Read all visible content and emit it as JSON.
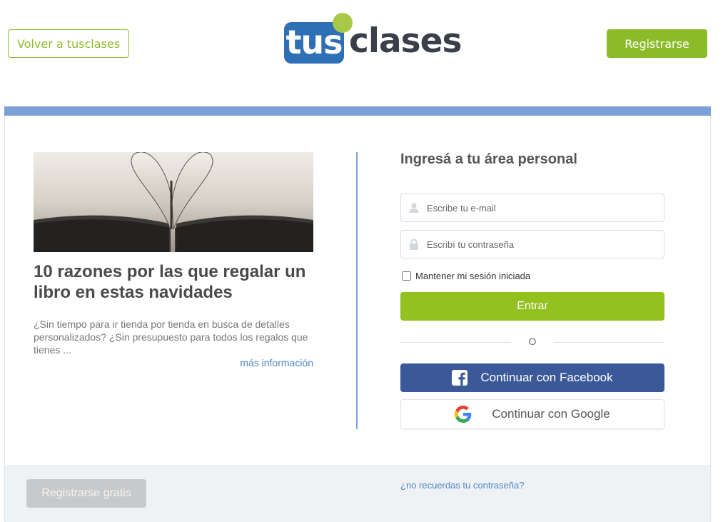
{
  "header": {
    "back_label": "Volver a tusclases",
    "register_label": "Registrarse",
    "logo": {
      "part1": "tus",
      "part2": "clases"
    }
  },
  "article": {
    "image": "open-book-heart-pages",
    "title": "10 razones por las que regalar un libro en estas navidades",
    "description": "¿Sin tiempo para ir tienda por tienda en busca de detalles personalizados? ¿Sin presupuesto para todos los regalos que tienes ...",
    "more_link": "más información"
  },
  "login": {
    "title": "Ingresá a tu área personal",
    "email_placeholder": "Escribe tu e-mail",
    "password_placeholder": "Escribí tu contraseña",
    "remember_label": "Mantener mi sesión iniciada",
    "enter_label": "Entrar",
    "or_label": "O",
    "facebook_label": "Continuar con Facebook",
    "google_label": "Continuar con Google"
  },
  "footer": {
    "register_free_label": "Registrarse gratis",
    "forgot_label": "¿no recuerdas tu contraseña?"
  },
  "colors": {
    "brand_green": "#93c11f",
    "brand_blue": "#2e6fb6",
    "accent_bar": "#7ba1d6",
    "facebook": "#3b5998"
  }
}
